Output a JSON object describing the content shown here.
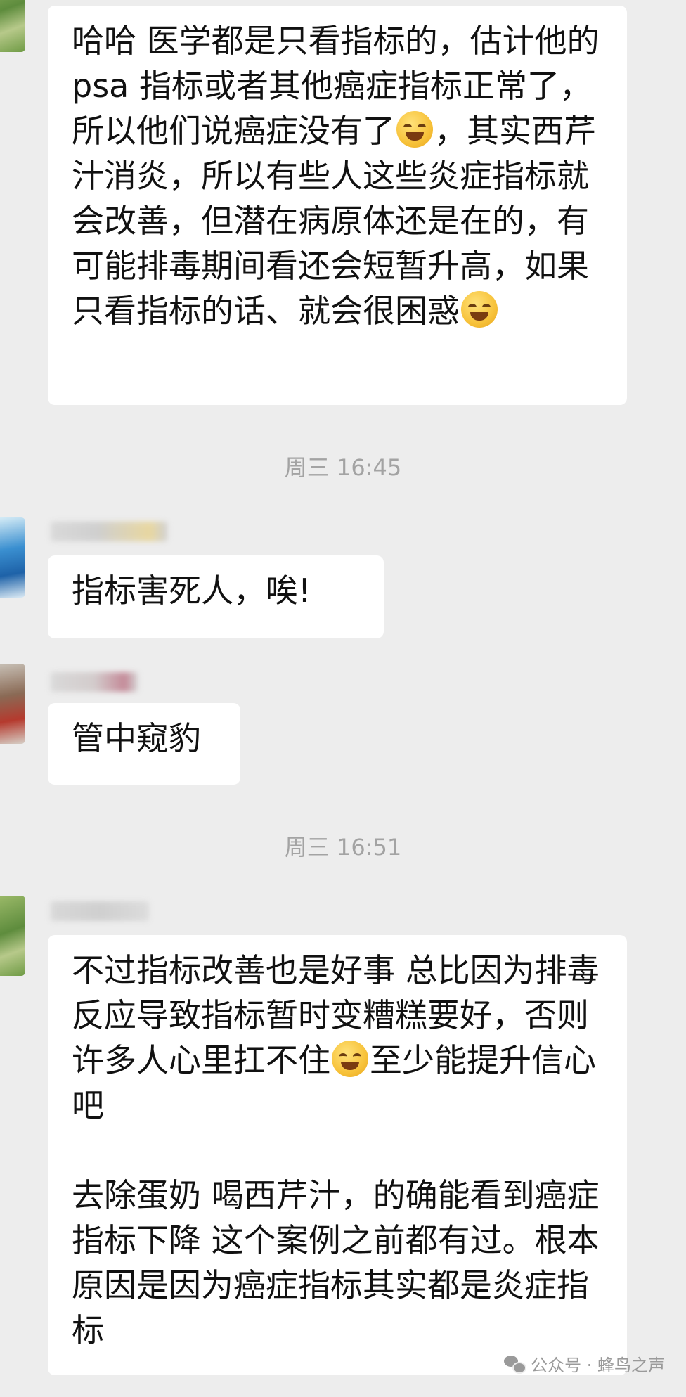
{
  "messages": [
    {
      "text_parts": [
        "哈哈 医学都是只看指标的，估计他的psa 指标或者其他癌症指标正常了，所以他们说癌症没有了",
        "，其实西芹汁消炎，所以有些人这些炎症指标就会改善，但潜在病原体还是在的，有可能排毒期间看还会短暂升高，如果只看指标的话、就会很困惑"
      ]
    },
    {
      "text": "指标害死人，唉!"
    },
    {
      "text": "管中窥豹"
    },
    {
      "text_parts": [
        "不过指标改善也是好事 总比因为排毒反应导致指标暂时变糟糕要好，否则许多人心里扛不住",
        "至少能提升信心吧\n\n去除蛋奶 喝西芹汁，的确能看到癌症指标下降 这个案例之前都有过。根本原因是因为癌症指标其实都是炎症指标"
      ]
    }
  ],
  "timestamps": [
    "周三 16:45",
    "周三 16:51"
  ],
  "emoji_names": [
    "facepalm-emoji",
    "laughing-tears-emoji",
    "facepalm-emoji"
  ],
  "watermark": {
    "icon": "wechat-icon",
    "text": "公众号 · 蜂鸟之声"
  }
}
